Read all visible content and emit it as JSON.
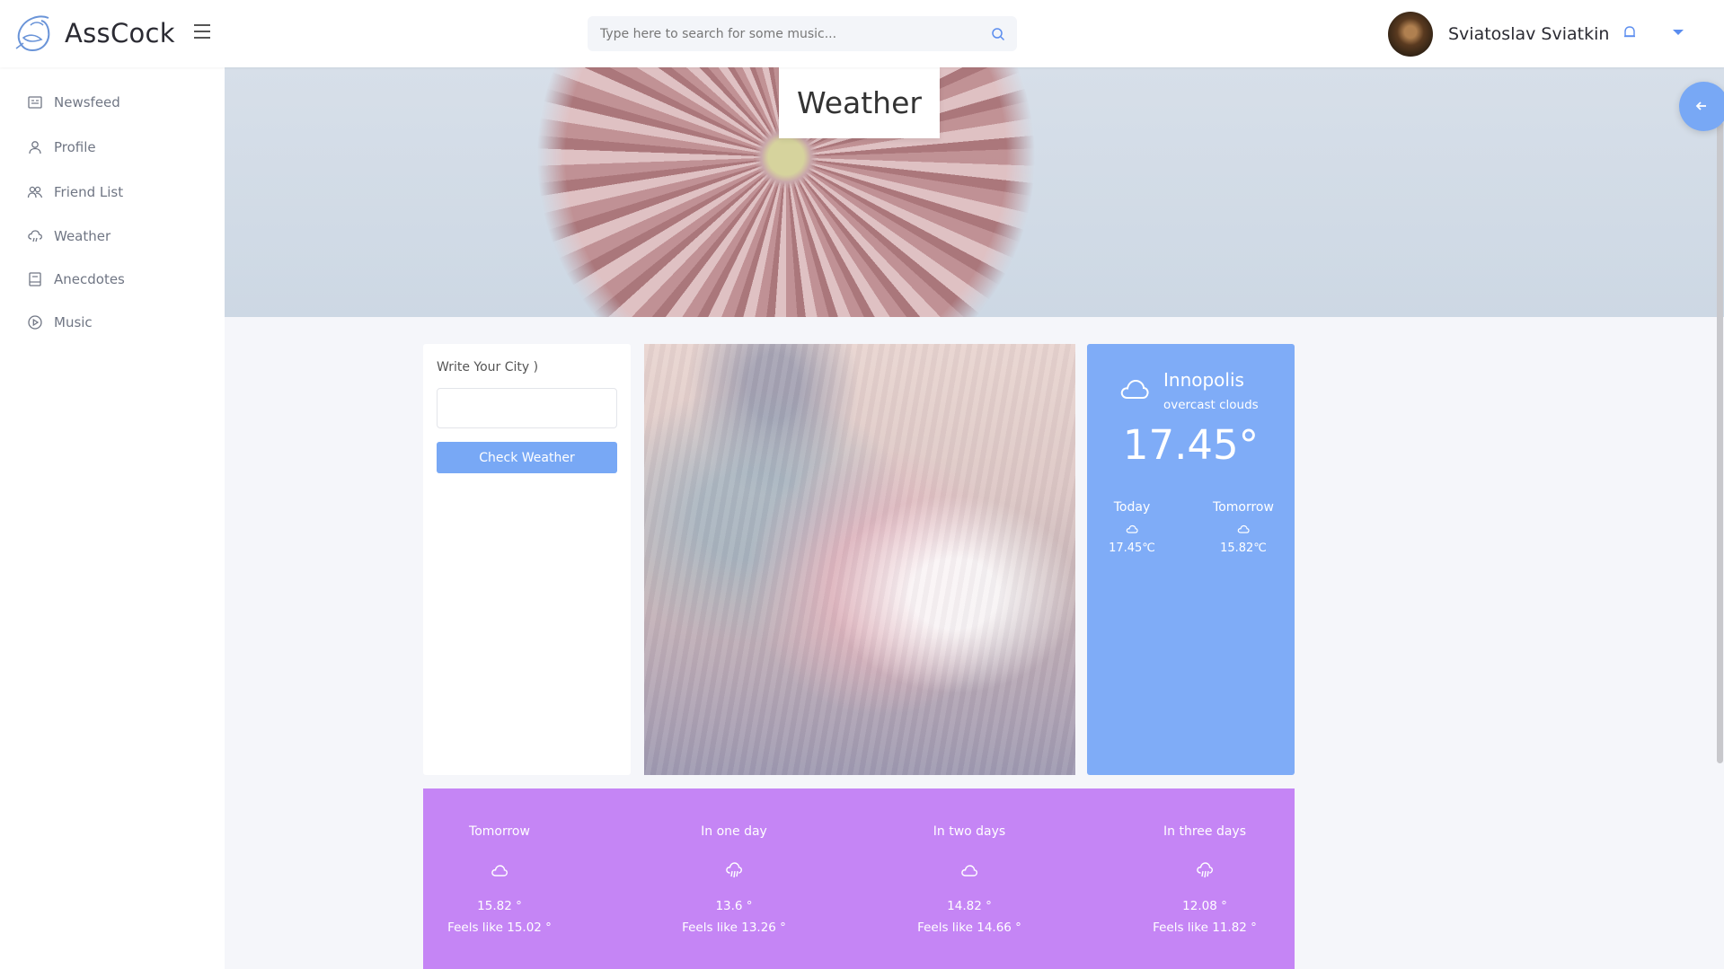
{
  "header": {
    "brand": "AssCock",
    "search_placeholder": "Type here to search for some music...",
    "user_name": "Sviatoslav Sviatkin"
  },
  "sidebar": {
    "items": [
      {
        "label": "Newsfeed",
        "icon": "newspaper-icon"
      },
      {
        "label": "Profile",
        "icon": "user-icon"
      },
      {
        "label": "Friend List",
        "icon": "users-icon"
      },
      {
        "label": "Weather",
        "icon": "cloud-rain-icon"
      },
      {
        "label": "Anecdotes",
        "icon": "book-icon"
      },
      {
        "label": "Music",
        "icon": "play-circle-icon"
      }
    ]
  },
  "page": {
    "title": "Weather"
  },
  "city_form": {
    "label": "Write Your City )",
    "input_value": "",
    "button_label": "Check Weather"
  },
  "current": {
    "city": "Innopolis",
    "description": "overcast clouds",
    "temperature": "17.45°",
    "today_label": "Today",
    "today_temp": "17.45℃",
    "tomorrow_label": "Tomorrow",
    "tomorrow_temp": "15.82℃"
  },
  "forecast": [
    {
      "label": "Tomorrow",
      "icon": "cloud-icon",
      "temp": "15.82 °",
      "feels": "Feels like 15.02 °"
    },
    {
      "label": "In one day",
      "icon": "cloud-rain-icon",
      "temp": "13.6 °",
      "feels": "Feels like 13.26 °"
    },
    {
      "label": "In two days",
      "icon": "cloud-icon",
      "temp": "14.82 °",
      "feels": "Feels like 14.66 °"
    },
    {
      "label": "In three days",
      "icon": "cloud-rain-icon",
      "temp": "12.08 °",
      "feels": "Feels like 11.82 °"
    }
  ],
  "colors": {
    "accent_blue": "#78a8f5",
    "current_card": "#7facf7",
    "forecast_bg": "#c585f5",
    "sidebar_text": "#707684"
  }
}
